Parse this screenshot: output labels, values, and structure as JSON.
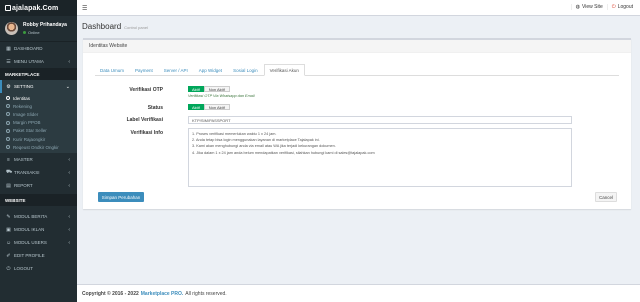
{
  "brand": {
    "logo_text": "ajalapak.Com"
  },
  "user": {
    "name": "Robby Prihandaya",
    "status": "Online"
  },
  "sidebar": {
    "top_items": [
      {
        "label": "DASHBOARD",
        "icon": "dashboard-icon"
      },
      {
        "label": "MENU UTAMA",
        "icon": "menu-icon"
      }
    ],
    "header_marketplace": "MARKETPLACE",
    "setting": {
      "label": "SETTING",
      "icon": "gear-icon"
    },
    "sub_items": [
      "Identitas",
      "Rekening",
      "Image Slider",
      "Margin PPOB",
      "Paket Star Seller",
      "Kurir Rajaongkir",
      "Reqeust Ondkir Ongkir"
    ],
    "mid_items": [
      {
        "label": "MASTER",
        "icon": "list-icon"
      },
      {
        "label": "TRANSAKSI",
        "icon": "cart-icon"
      },
      {
        "label": "REPORT",
        "icon": "file-icon"
      }
    ],
    "header_website": "WEBSITE",
    "web_items": [
      {
        "label": "MODUL BERITA",
        "icon": "pencil-icon"
      },
      {
        "label": "MODUL IKLAN",
        "icon": "ad-icon"
      },
      {
        "label": "MODUL USERS",
        "icon": "users-icon"
      },
      {
        "label": "EDIT PROFILE",
        "icon": "edit-icon"
      },
      {
        "label": "LOGOUT",
        "icon": "power-icon"
      }
    ]
  },
  "topbar": {
    "view_site": "View Site",
    "logout": "Logout"
  },
  "page": {
    "title": "Dashboard",
    "subtitle": "Control panel"
  },
  "box": {
    "title": "Identitas Website"
  },
  "tabs": [
    "Data Umum",
    "Payment",
    "Server / API",
    "App Widget",
    "Sosial Login",
    "Verifikasi Akun"
  ],
  "form": {
    "otp_label": "Verifikasi OTP",
    "otp_on": "Aktif",
    "otp_off": "Non Aktif",
    "otp_help": "Verifikasi OTP Via Whatsapp dan Email",
    "status_label": "Status",
    "status_on": "Aktif",
    "status_off": "Non Aktif",
    "label_label": "Label Verifikasi",
    "label_value": "KTP/SIM/PASSPORT",
    "info_label": "Verifikasi Info",
    "info_lines": [
      "1. Proses verifikasi memerlukan waktu 1 x 24 jam.",
      "2. Anda tetap bisa login menggunakan layanan di marketplace Tajalapak ini.",
      "3. Kami akan menghubungi anda via email atau WA jika terjadi kekurangan dokumen.",
      "4. Jika dalam 1 x 24 jam anda belum mendapatkan verifikasi, silahkan hubungi kami di sales@tajalapak.com"
    ],
    "save": "Simpan Perubahan",
    "cancel": "Cancel"
  },
  "footer": {
    "copyright": "Copyright © 2016 - 2022",
    "brand": "Marketplace PRO.",
    "rights": "All rights reserved."
  }
}
